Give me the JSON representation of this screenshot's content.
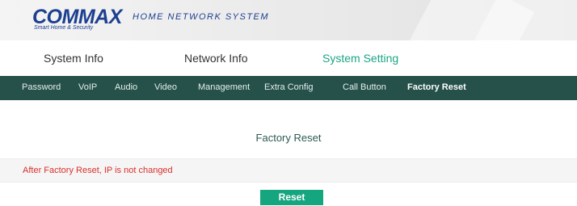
{
  "header": {
    "logo": "COMMAX",
    "logo_tagline": "Smart Home & Security",
    "title": "HOME NETWORK SYSTEM"
  },
  "top_tabs": [
    {
      "label": "System Info",
      "active": false
    },
    {
      "label": "Network Info",
      "active": false
    },
    {
      "label": "System Setting",
      "active": true
    }
  ],
  "sub_nav": [
    {
      "label": "Password",
      "active": false
    },
    {
      "label": "VoIP",
      "active": false
    },
    {
      "label": "Audio",
      "active": false
    },
    {
      "label": "Video",
      "active": false
    },
    {
      "label": "Management",
      "active": false
    },
    {
      "label": "Extra Config",
      "active": false
    },
    {
      "label": "Call Button",
      "active": false
    },
    {
      "label": "Factory Reset",
      "active": true
    }
  ],
  "main": {
    "section_title": "Factory Reset",
    "notice": "After Factory Reset, IP is not changed",
    "reset_label": "Reset"
  },
  "colors": {
    "brand_blue": "#1c3f8f",
    "active_tab": "#1aa583",
    "subnav_bg": "#25514a",
    "notice_red": "#d9302c",
    "button_green": "#16a67f"
  }
}
